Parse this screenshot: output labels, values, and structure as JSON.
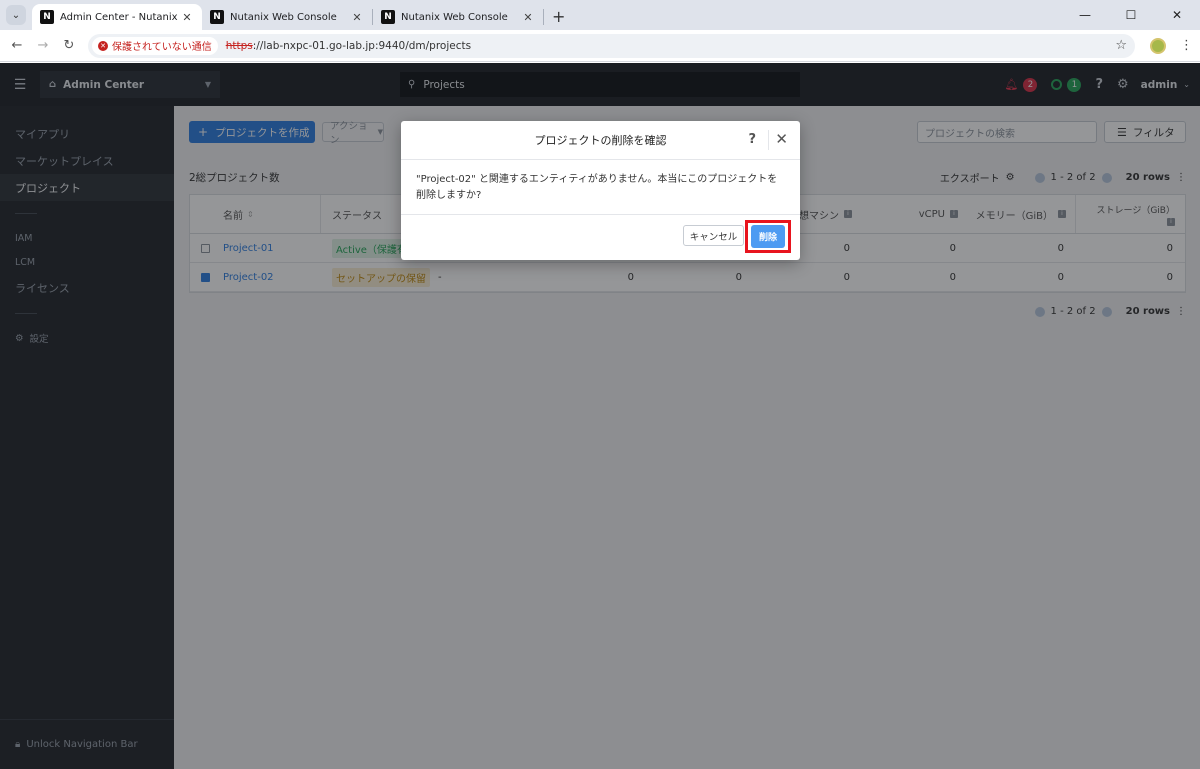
{
  "browser": {
    "tabs": [
      {
        "title": "Admin Center - Nutanix",
        "active": true
      },
      {
        "title": "Nutanix Web Console",
        "active": false
      },
      {
        "title": "Nutanix Web Console",
        "active": false
      }
    ],
    "security_text": "保護されていない通信",
    "url_scheme": "https",
    "url_rest": "://lab-nxpc-01.go-lab.jp:9440/dm/projects"
  },
  "header": {
    "app_name": "Admin Center",
    "search_text": "Projects",
    "alerts_count": "2",
    "tasks_count": "1",
    "user": "admin"
  },
  "sidebar": {
    "items": [
      {
        "label": "マイアプリ"
      },
      {
        "label": "マーケットプレイス"
      },
      {
        "label": "プロジェクト"
      },
      {
        "label": "IAM"
      },
      {
        "label": "LCM"
      },
      {
        "label": "ライセンス"
      },
      {
        "label": "設定"
      }
    ],
    "unlock_label": "Unlock Navigation Bar"
  },
  "main": {
    "create_button": "プロジェクトを作成",
    "action_button": "アクション",
    "search_placeholder": "プロジェクトの検索",
    "filter_button": "フィルタ",
    "count_label": "2総プロジェクト数",
    "export_label": "エクスポート",
    "pager_text": "1 - 2 of 2",
    "rows_label": "20 rows",
    "columns": {
      "name": "名前",
      "status": "ステータス",
      "vm": "仮想マシン",
      "vcpu": "vCPU",
      "memory": "メモリー（GiB）",
      "storage": "ストレージ（GiB）"
    },
    "rows": [
      {
        "name": "Project-01",
        "status": "Active（保護有",
        "c1": "",
        "c2": "",
        "vm": "0",
        "vcpu": "0",
        "memory": "0",
        "storage": "0",
        "checked": false
      },
      {
        "name": "Project-02",
        "status": "セットアップの保留",
        "dash": "-",
        "c1": "0",
        "c2": "0",
        "vm": "0",
        "vcpu": "0",
        "memory": "0",
        "storage": "0",
        "checked": true
      }
    ]
  },
  "modal": {
    "title": "プロジェクトの削除を確認",
    "body": "\"Project-02\" と関連するエンティティがありません。本当にこのプロジェクトを削除しますか?",
    "cancel_label": "キャンセル",
    "delete_label": "削除"
  }
}
